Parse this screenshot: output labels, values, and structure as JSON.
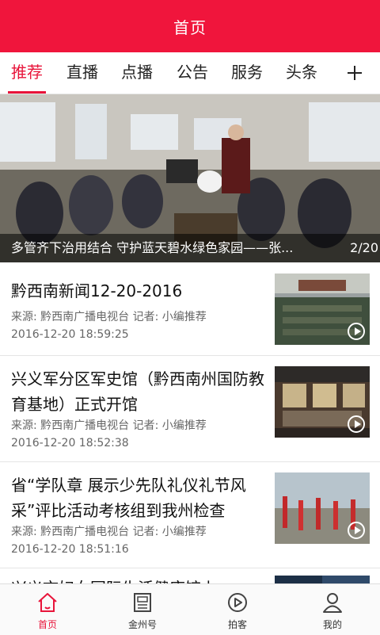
{
  "header": {
    "title": "首页"
  },
  "tabs": [
    {
      "label": "推荐",
      "active": true
    },
    {
      "label": "直播"
    },
    {
      "label": "点播"
    },
    {
      "label": "公告"
    },
    {
      "label": "服务"
    },
    {
      "label": "头条"
    }
  ],
  "banner": {
    "caption": "多管齐下治用结合 守护蓝天碧水绿色家园——张...",
    "counter": "2/20"
  },
  "news": [
    {
      "title": "黔西南新闻12-20-2016",
      "meta": "来源: 黔西南广播电视台  记者: 小编推荐",
      "time": "2016-12-20 18:59:25"
    },
    {
      "title": "兴义军分区军史馆（黔西南州国防教育基地）正式开馆",
      "meta": "来源: 黔西南广播电视台  记者: 小编推荐",
      "time": "2016-12-20 18:52:38"
    },
    {
      "title": "省“学队章 展示少先队礼仪礼节风采”评比活动考核组到我州检查",
      "meta": "来源: 黔西南广播电视台  记者: 小编推荐",
      "time": "2016-12-20 18:51:16"
    },
    {
      "title": "兴义市妇女国际生活健康馆上"
    }
  ],
  "bottom_nav": [
    {
      "label": "首页",
      "icon": "home-icon",
      "active": true
    },
    {
      "label": "金州号",
      "icon": "newspaper-icon"
    },
    {
      "label": "拍客",
      "icon": "play-circle-icon"
    },
    {
      "label": "我的",
      "icon": "user-icon"
    }
  ],
  "colors": {
    "brand": "#f0153c",
    "accent": "#e8143a"
  }
}
